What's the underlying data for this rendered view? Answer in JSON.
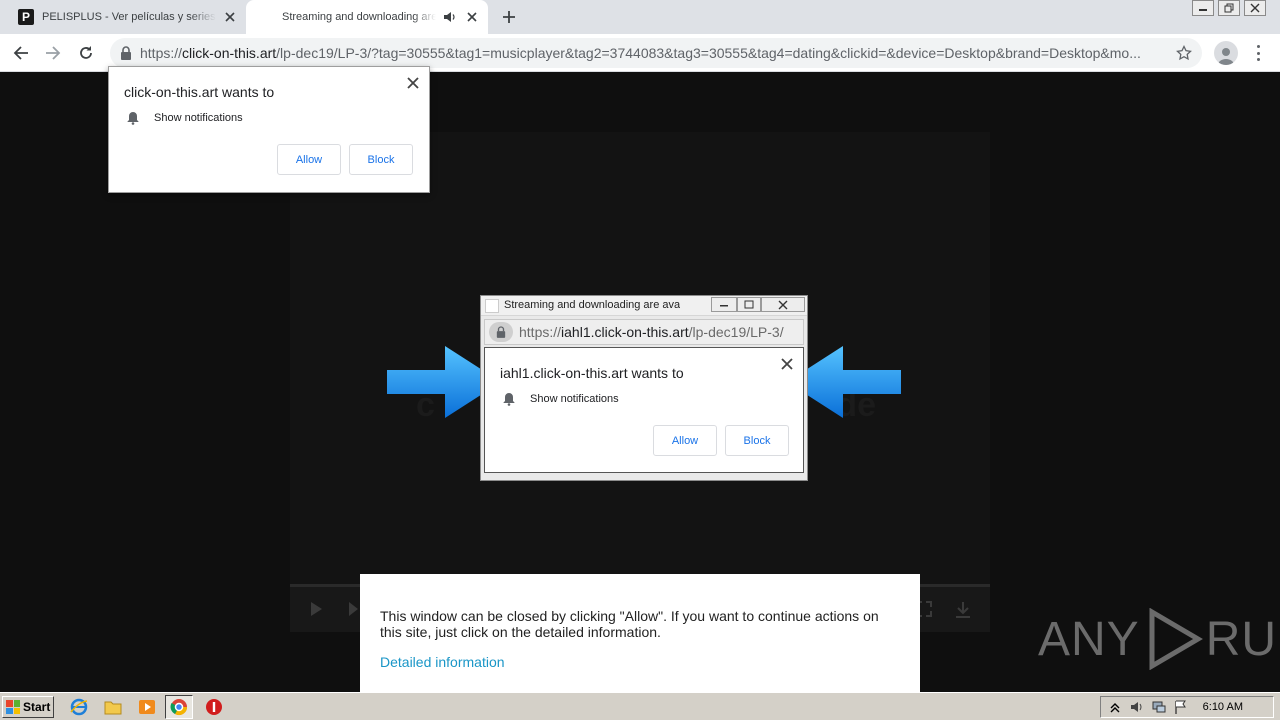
{
  "browser": {
    "tabs": [
      {
        "favicon": "P",
        "title": "PELISPLUS - Ver películas y series online",
        "active": false
      },
      {
        "title": "Streaming and downloading are available",
        "active": true,
        "audio_icon": "speaker-icon"
      }
    ],
    "address": {
      "scheme": "https://",
      "host": "click-on-this.art",
      "path": "/lp-dec19/LP-3/?tag=30555&tag1=musicplayer&tag2=3744083&tag3=30555&tag4=dating&clickid=&device=Desktop&brand=Desktop&mo..."
    }
  },
  "permission_prompt_main": {
    "title": "click-on-this.art wants to",
    "permission": "Show notifications",
    "allow_label": "Allow",
    "block_label": "Block"
  },
  "popup_window": {
    "title": "Streaming and downloading are available",
    "address": {
      "scheme": "https://",
      "host": "iahl1.click-on-this.art",
      "path": "/lp-dec19/LP-3/"
    },
    "prompt": {
      "title": "iahl1.click-on-this.art wants to",
      "permission": "Show notifications",
      "allow_label": "Allow",
      "block_label": "Block"
    }
  },
  "page": {
    "notice_text": "This window can be closed by clicking \"Allow\". If you want to continue actions on this site, just click on the detailed information.",
    "notice_link": "Detailed information",
    "watermark": "ANY RUN",
    "watermark_left": "ANY",
    "watermark_right": "RUN",
    "arrow_color": "#1e90ff"
  },
  "taskbar": {
    "start_label": "Start",
    "clock": "6:10 AM",
    "apps": [
      "ie-icon",
      "folder-icon",
      "media-player-icon",
      "chrome-icon",
      "stop-icon"
    ]
  }
}
